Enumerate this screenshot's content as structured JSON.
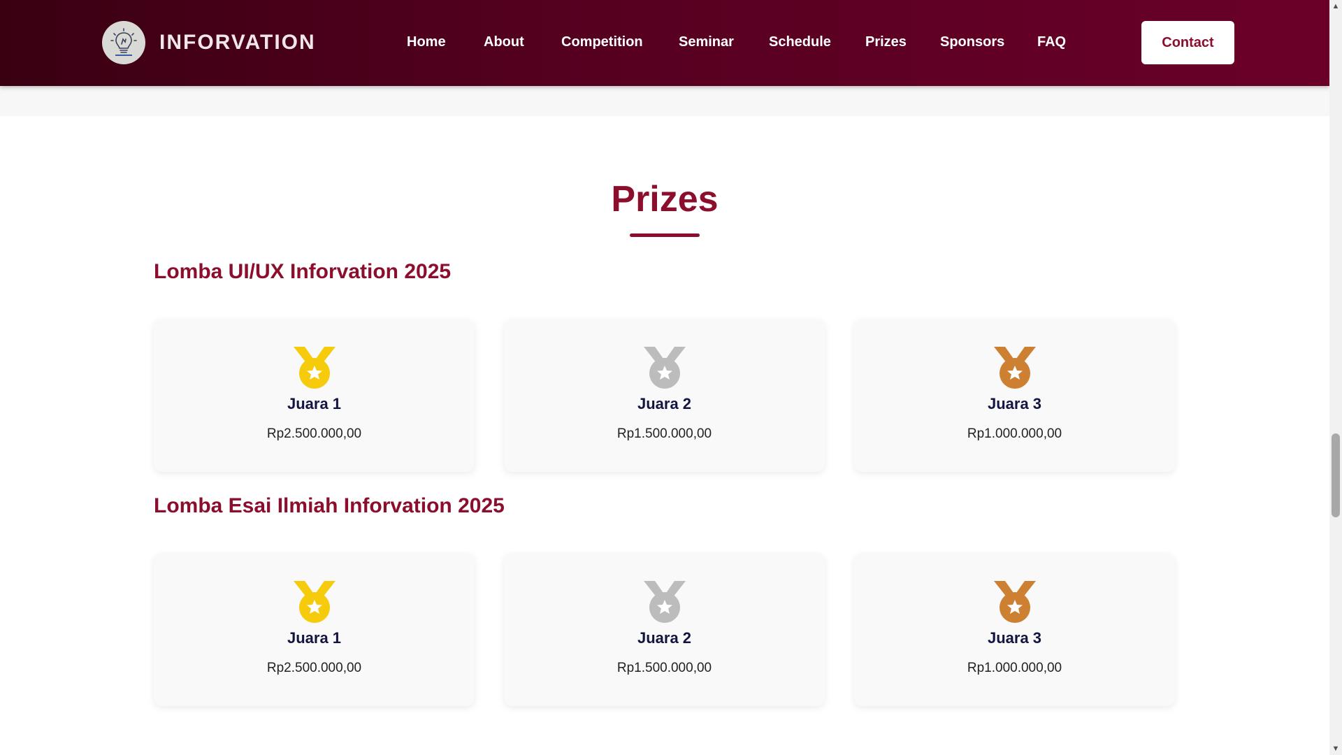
{
  "header": {
    "brand_name": "INFORVATION",
    "nav": [
      "Home",
      "About",
      "Competition",
      "Seminar",
      "Schedule",
      "Prizes",
      "Sponsors",
      "FAQ"
    ],
    "contact_label": "Contact",
    "colors": {
      "gradient_start": "#3a0012",
      "gradient_end": "#6a0028"
    }
  },
  "prizes": {
    "title": "Prizes",
    "accent_color": "#8b0e2d",
    "groups": [
      {
        "title": "Lomba UI/UX Inforvation 2025",
        "cards": [
          {
            "rank": "Juara 1",
            "amount": "Rp2.500.000,00",
            "medal": "gold-medal-icon",
            "color": "#f5cb0c"
          },
          {
            "rank": "Juara 2",
            "amount": "Rp1.500.000,00",
            "medal": "silver-medal-icon",
            "color": "#bcbcbc"
          },
          {
            "rank": "Juara 3",
            "amount": "Rp1.000.000,00",
            "medal": "bronze-medal-icon",
            "color": "#cd7f32"
          }
        ]
      },
      {
        "title": "Lomba Esai Ilmiah Inforvation 2025",
        "cards": [
          {
            "rank": "Juara 1",
            "amount": "Rp2.500.000,00",
            "medal": "gold-medal-icon",
            "color": "#f5cb0c"
          },
          {
            "rank": "Juara 2",
            "amount": "Rp1.500.000,00",
            "medal": "silver-medal-icon",
            "color": "#bcbcbc"
          },
          {
            "rank": "Juara 3",
            "amount": "Rp1.000.000,00",
            "medal": "bronze-medal-icon",
            "color": "#cd7f32"
          }
        ]
      }
    ]
  }
}
